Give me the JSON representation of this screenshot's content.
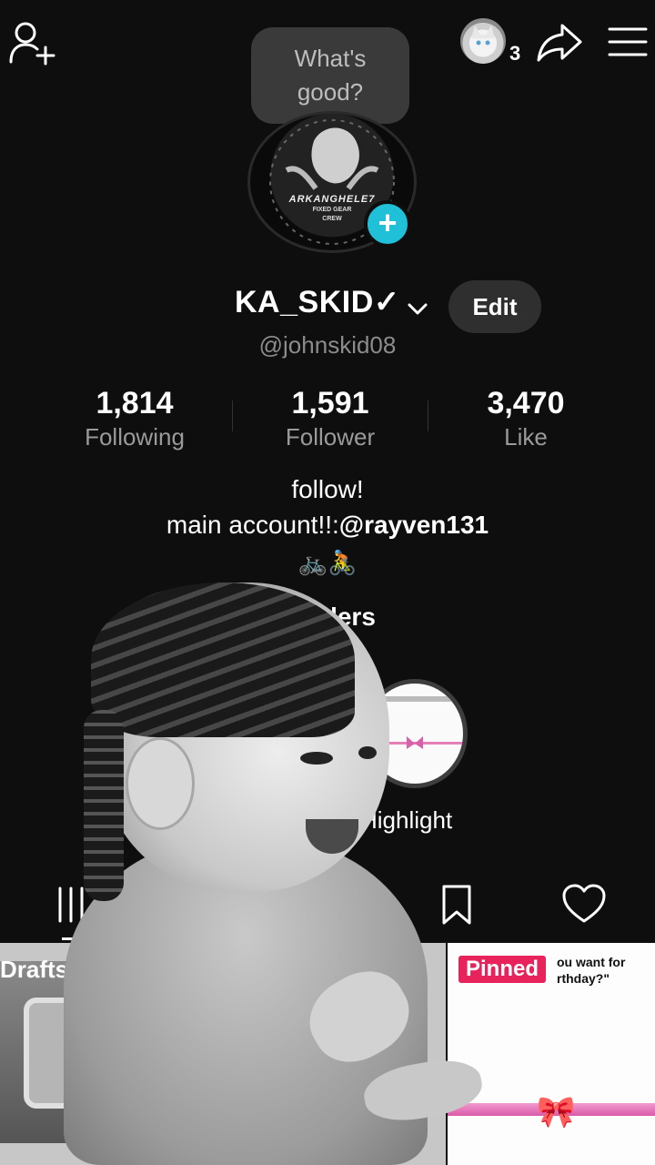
{
  "bubble": {
    "line1": "What's",
    "line2": "good?"
  },
  "topbar": {
    "viewer_count": "3"
  },
  "profile": {
    "logo_text": "ARKANGHELE7",
    "logo_sub1": "FIXED GEAR",
    "logo_sub2": "CREW",
    "name": "KA_SKID✓",
    "edit_label": "Edit",
    "handle": "@johnskid08"
  },
  "stats": [
    {
      "value": "1,814",
      "label": "Following"
    },
    {
      "value": "1,591",
      "label": "Follower"
    },
    {
      "value": "3,470",
      "label": "Like"
    }
  ],
  "bio": {
    "line1": "follow!",
    "line2_prefix": "main account!!:",
    "line2_mention": "@rayven131",
    "line3": "🚲🚴"
  },
  "orders_label": "r orders",
  "highlight": {
    "label": "Highlight"
  },
  "grid": {
    "drafts_label": "Drafts: ",
    "pinned_label": "Pinned",
    "caption_line1": "ou want for",
    "caption_line2": "rthday?\""
  }
}
